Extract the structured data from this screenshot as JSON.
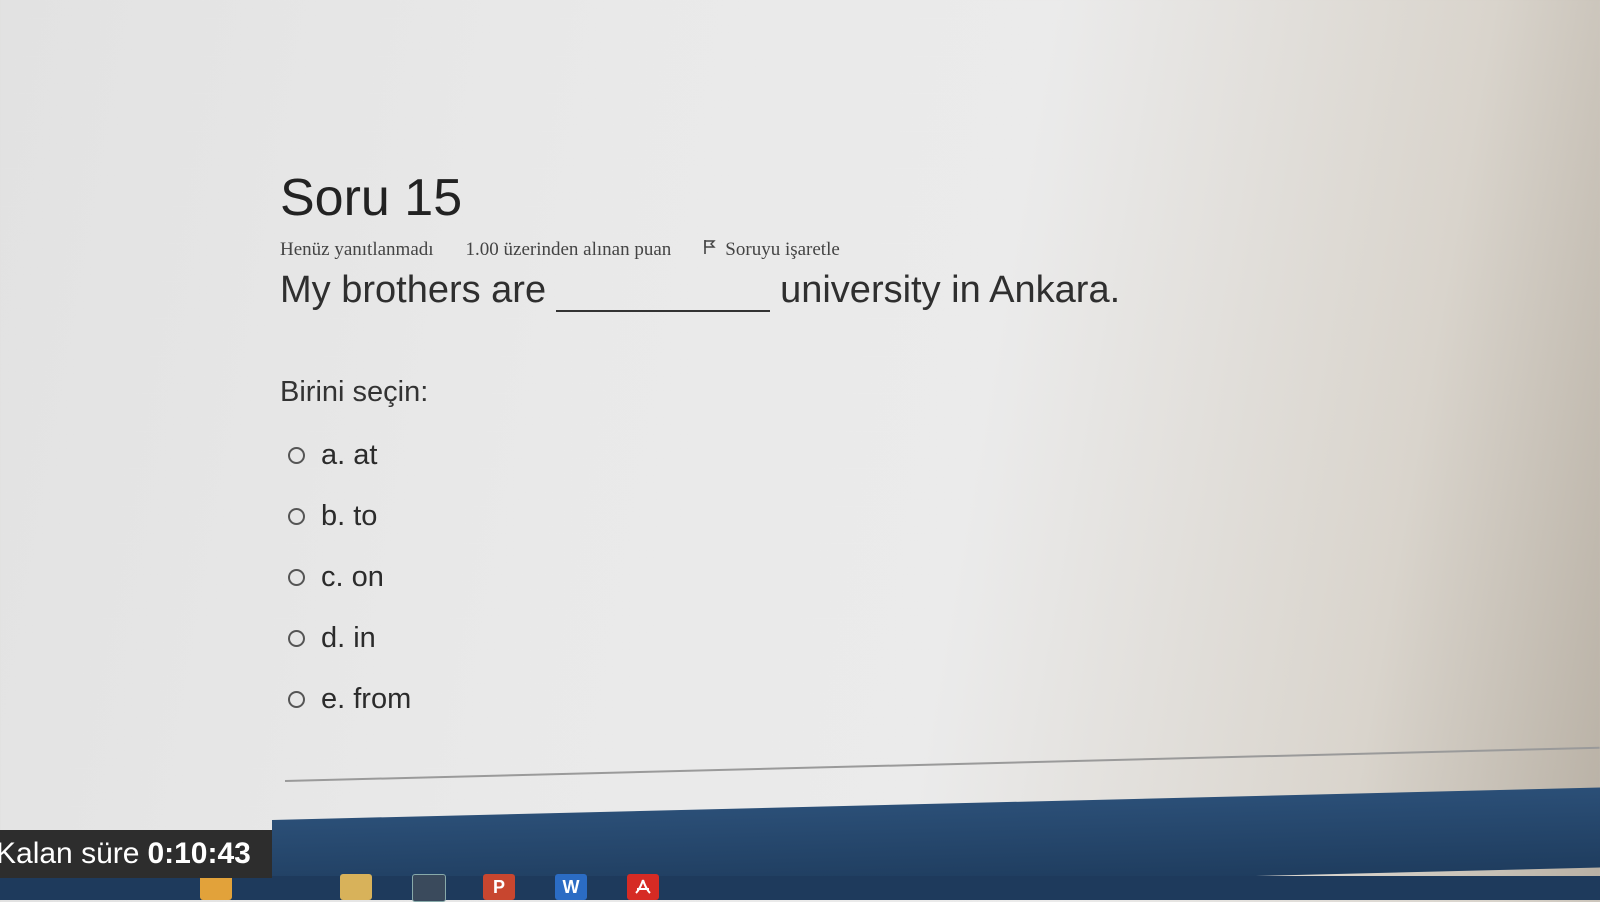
{
  "question": {
    "title": "Soru 15",
    "status": "Henüz yanıtlanmadı",
    "points": "1.00 üzerinden alınan puan",
    "flag_label": "Soruyu işaretle",
    "flag_icon": "flag-icon",
    "text_before": "My brothers are",
    "text_after": "university in Ankara.",
    "prompt": "Birini seçin:",
    "options": [
      {
        "label": "a. at"
      },
      {
        "label": "b. to"
      },
      {
        "label": "c. on"
      },
      {
        "label": "d. in"
      },
      {
        "label": "e. from"
      }
    ]
  },
  "timer": {
    "label": "Kalan süre",
    "value": "0:10:43"
  },
  "taskbar": {
    "icons": [
      "explorer-icon",
      "console-icon",
      "powerpoint-icon",
      "word-icon",
      "acrobat-icon"
    ],
    "word_letter": "W",
    "powerpoint_letter": "P"
  },
  "colors": {
    "taskbar": "#1f3d5f",
    "timer_bg": "#2d2d2d",
    "powerpoint": "#c8462f",
    "word": "#2b6cc4",
    "acrobat": "#d62b24"
  }
}
